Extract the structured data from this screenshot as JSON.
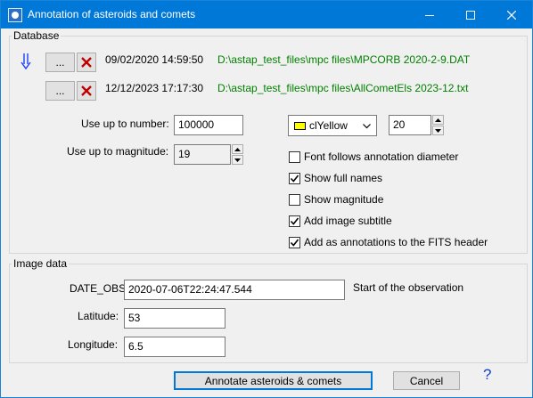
{
  "window": {
    "title": "Annotation of asteroids and comets",
    "icon": "app-icon",
    "controls": {
      "minimize": "minimize-icon",
      "maximize": "maximize-icon",
      "close": "close-icon"
    }
  },
  "database": {
    "group_label": "Database",
    "nav_icon": "arrow-down-icon",
    "files": [
      {
        "browse_label": "...",
        "delete_icon": "red-x-icon",
        "timestamp": "09/02/2020 14:59:50",
        "path": "D:\\astap_test_files\\mpc files\\MPCORB 2020-2-9.DAT"
      },
      {
        "browse_label": "...",
        "delete_icon": "red-x-icon",
        "timestamp": "12/12/2023 17:17:30",
        "path": "D:\\astap_test_files\\mpc files\\AllCometEls 2023-12.txt"
      }
    ],
    "use_up_to_number": {
      "label": "Use up to number:",
      "value": "100000"
    },
    "use_up_to_magnitude": {
      "label": "Use up to magnitude:",
      "value": "19"
    },
    "color_select": {
      "value": "clYellow",
      "swatch_color": "#ffff00"
    },
    "font_size": {
      "value": "20"
    },
    "options": [
      {
        "label": "Font follows annotation diameter",
        "checked": false
      },
      {
        "label": "Show full names",
        "checked": true
      },
      {
        "label": "Show magnitude",
        "checked": false
      },
      {
        "label": "Add image subtitle",
        "checked": true
      },
      {
        "label": "Add as annotations to the FITS header",
        "checked": true
      }
    ]
  },
  "image_data": {
    "group_label": "Image data",
    "date_obs": {
      "label": "DATE_OBS",
      "value": "2020-07-06T22:24:47.544",
      "note": "Start of the observation"
    },
    "latitude": {
      "label": "Latitude:",
      "value": "53"
    },
    "longitude": {
      "label": "Longitude:",
      "value": "6.5"
    }
  },
  "footer": {
    "annotate_label": "Annotate asteroids & comets",
    "cancel_label": "Cancel",
    "help_label": "?"
  }
}
